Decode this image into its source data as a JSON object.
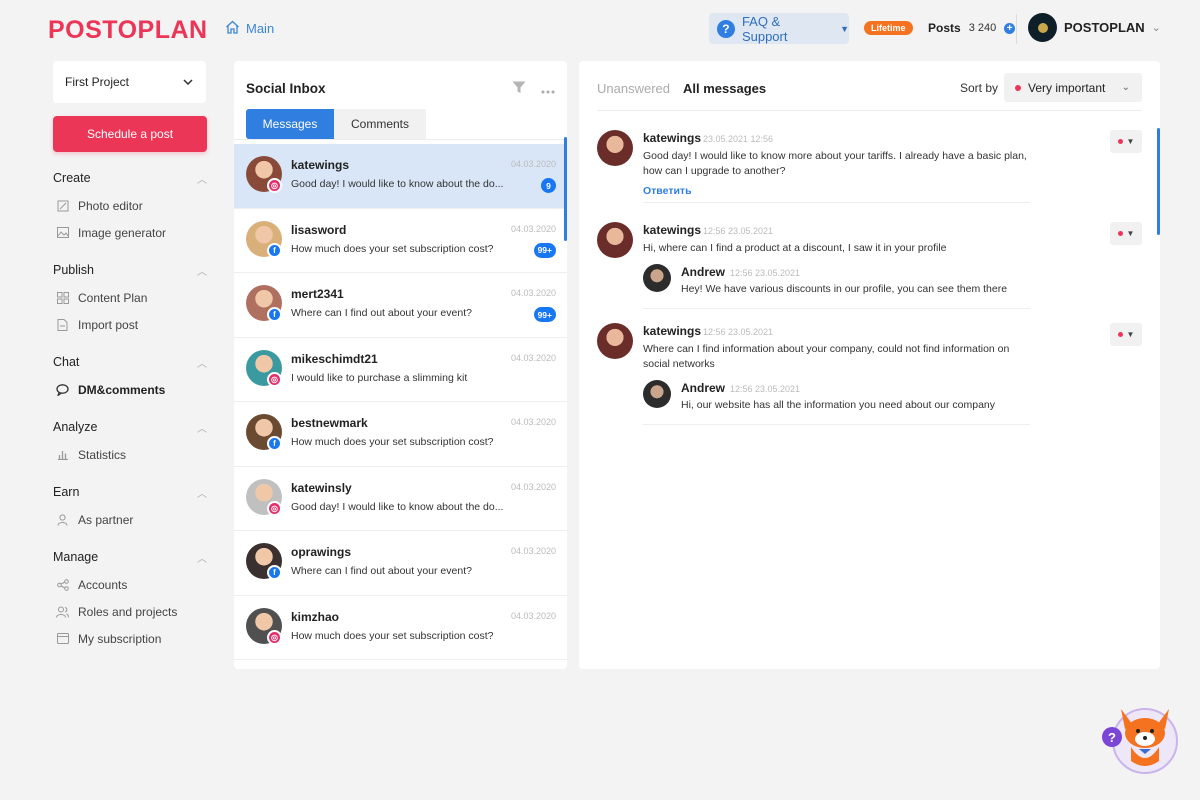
{
  "header": {
    "logo": "POSTOPLAN",
    "breadcrumb": "Main",
    "faq_label": "FAQ & Support",
    "plan_badge": "Lifetime",
    "posts_label": "Posts",
    "posts_count": "3 240",
    "account_name": "POSTOPLAN"
  },
  "sidebar": {
    "project": "First Project",
    "schedule_label": "Schedule a post",
    "groups": [
      {
        "title": "Create",
        "items": [
          "Photo editor",
          "Image generator"
        ]
      },
      {
        "title": "Publish",
        "items": [
          "Content Plan",
          "Import post"
        ]
      },
      {
        "title": "Chat",
        "items": [
          "DM&comments"
        ]
      },
      {
        "title": "Analyze",
        "items": [
          "Statistics"
        ]
      },
      {
        "title": "Earn",
        "items": [
          "As partner"
        ]
      },
      {
        "title": "Manage",
        "items": [
          "Accounts",
          "Roles and projects",
          "My subscription"
        ]
      }
    ]
  },
  "inbox": {
    "title": "Social Inbox",
    "tab_messages": "Messages",
    "tab_comments": "Comments",
    "conversations": [
      {
        "name": "katewings",
        "date": "04.03.2020",
        "message": "Good day! I would like to know about the do...",
        "count": "9",
        "network": "instagram"
      },
      {
        "name": "lisasword",
        "date": "04.03.2020",
        "message": "How much does your set subscription cost?",
        "count": "99+",
        "network": "facebook"
      },
      {
        "name": "mert2341",
        "date": "04.03.2020",
        "message": "Where can I find out about your event?",
        "count": "99+",
        "network": "facebook"
      },
      {
        "name": "mikeschimdt21",
        "date": "04.03.2020",
        "message": "I would like to purchase a slimming kit",
        "count": "",
        "network": "instagram"
      },
      {
        "name": "bestnewmark",
        "date": "04.03.2020",
        "message": "How much does your set subscription cost?",
        "count": "",
        "network": "facebook"
      },
      {
        "name": "katewinsly",
        "date": "04.03.2020",
        "message": "Good day! I would like to know about the do...",
        "count": "",
        "network": "instagram"
      },
      {
        "name": "oprawings",
        "date": "04.03.2020",
        "message": "Where can I find out about your event?",
        "count": "",
        "network": "facebook"
      },
      {
        "name": "kimzhao",
        "date": "04.03.2020",
        "message": "How much does your set subscription cost?",
        "count": "",
        "network": "instagram"
      }
    ]
  },
  "messages": {
    "tab_unanswered": "Unanswered",
    "tab_all": "All messages",
    "sort_label": "Sort by",
    "sort_value": "Very important",
    "threads": [
      {
        "name": "katewings",
        "time": "23.05.2021 12:56",
        "body": "Good day! I would like to know more about your tariffs. I already have a basic plan, how can I upgrade to another?",
        "reply_link": "Ответить"
      },
      {
        "name": "katewings",
        "time": "12:56 23.05.2021",
        "body": "Hi, where can I find a product at a discount, I saw it in your profile",
        "reply": {
          "name": "Andrew",
          "time": "12:56 23.05.2021",
          "body": "Hey! We have various discounts in our profile, you can see them there"
        }
      },
      {
        "name": "katewings",
        "time": "12:56 23.05.2021",
        "body": "Where can I find information about your company, could not find information on social networks",
        "reply": {
          "name": "Andrew",
          "time": "12:56 23.05.2021",
          "body": "Hi, our website has all the information you need about our company"
        }
      }
    ]
  },
  "colors": {
    "brand": "#ec3657",
    "accent_blue": "#2f7ee0",
    "lifetime_orange": "#f47220",
    "facebook": "#1877f2",
    "instagram": "#e1306c"
  },
  "icons": {
    "breadcrumb": "home-icon",
    "faq": "question-icon",
    "posts": "plus-circle-icon",
    "filter": "filter-icon",
    "more": "more-horizontal-icon",
    "helper": "fox-mascot-icon"
  }
}
